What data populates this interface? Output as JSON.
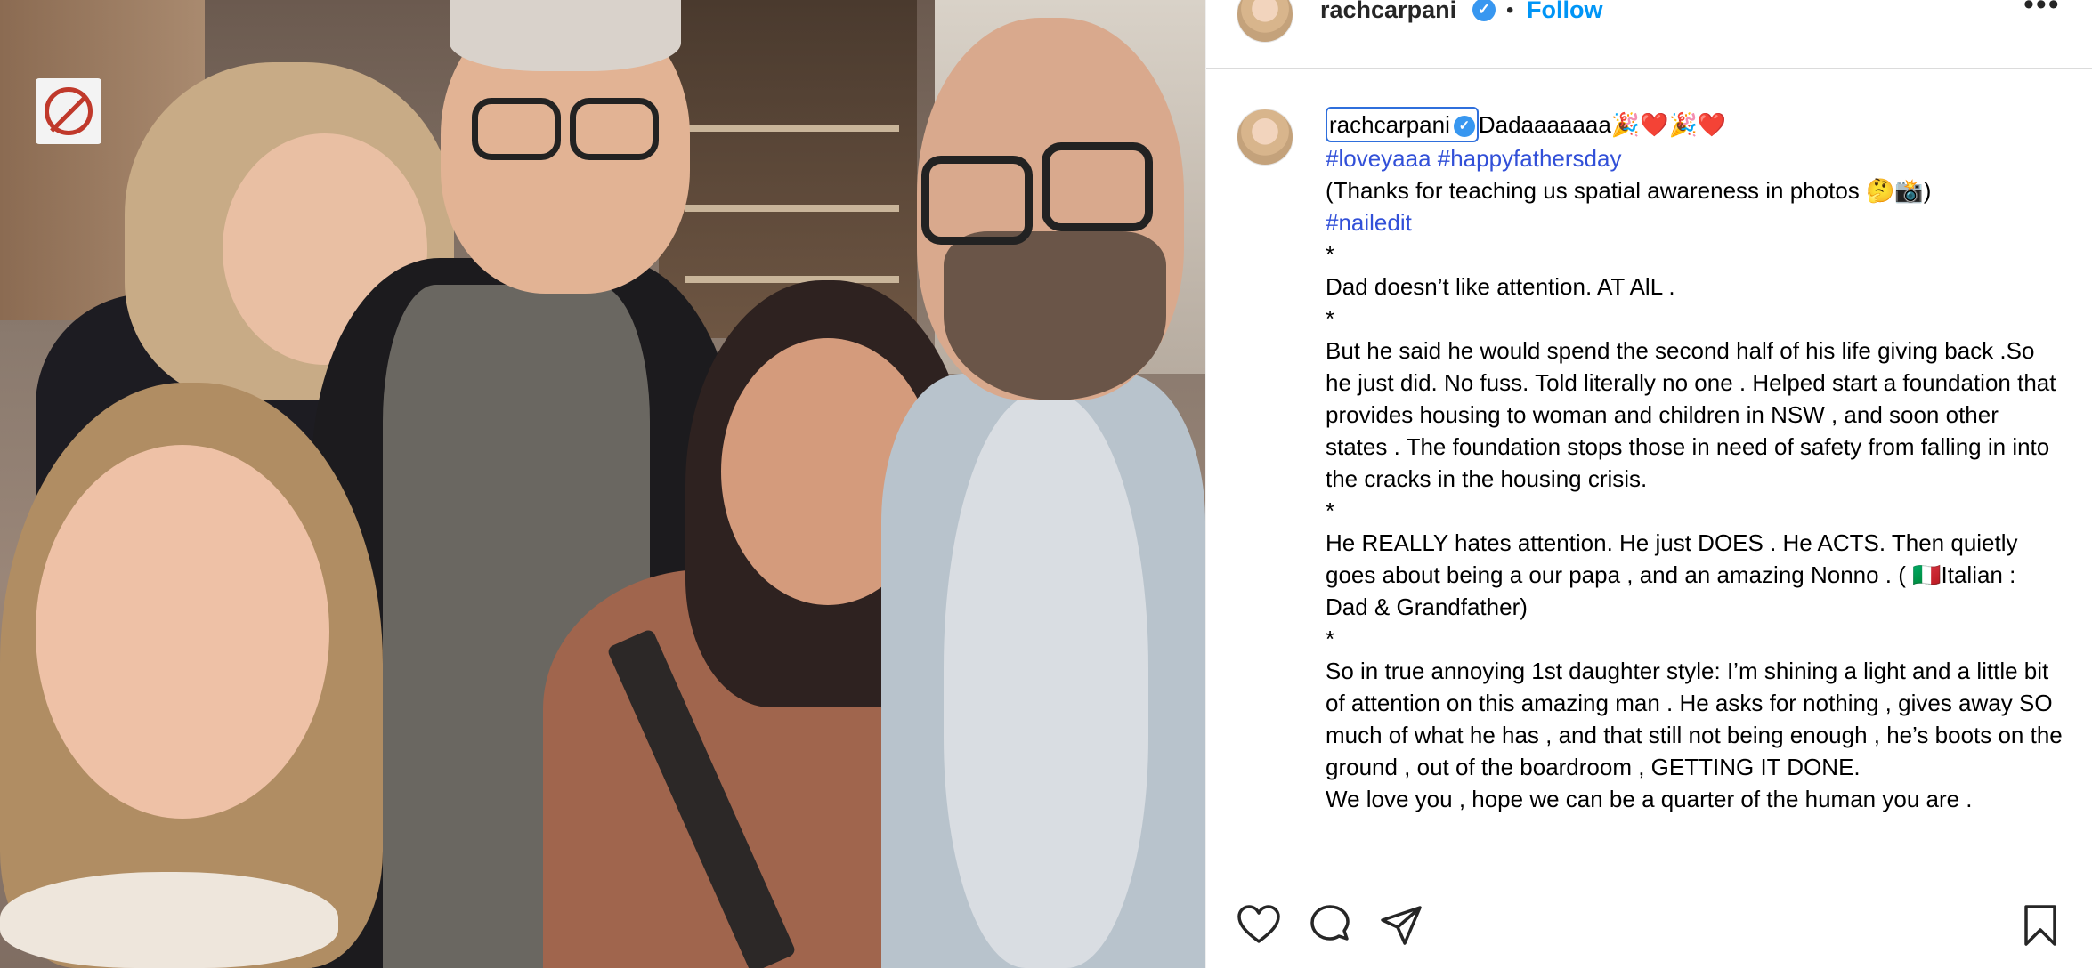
{
  "post": {
    "username": "rachcarpani",
    "verified_glyph": "✓",
    "follow_label": "Follow",
    "separator": "•",
    "more_glyph": "•••"
  },
  "caption": {
    "first_line_text": "Dadaaaaaaa🎉❤️🎉❤️",
    "hashtags_1": "#loveyaaa #happyfathersday",
    "thanks": "(Thanks for teaching us spatial awareness in photos 🤔📸)",
    "hashtags_2": "#nailedit",
    "star_1": "*",
    "para_1": "Dad doesn’t like attention. AT AlL .",
    "star_2": "*",
    "para_2": "But he said he would spend the second half of his life giving back .So he just did. No fuss. Told literally no one . Helped start a foundation that provides housing to woman and children in NSW , and soon other states . The foundation stops those in need of safety from falling in into the cracks in the housing crisis.",
    "star_3": "*",
    "para_3": "He REALLY hates attention. He just DOES . He ACTS. Then quietly goes about being a our papa , and an amazing Nonno . ( 🇮🇹Italian : Dad & Grandfather)",
    "star_4": "*",
    "para_4": "So in true annoying 1st daughter style: I’m shining a light and a little bit of attention on this amazing man . He asks for nothing , gives away SO much of what he has , and that still not being enough , he’s boots on the ground , out of the boardroom , GETTING IT DONE.",
    "para_5": "We love you , hope we can be a quarter of the human you are ."
  },
  "icons": {
    "avatar": "profile-avatar",
    "like": "heart-icon",
    "comment": "comment-bubble-icon",
    "share": "paper-plane-icon",
    "save": "bookmark-icon",
    "photo_sign": "no-smoking-sign"
  },
  "colors": {
    "link_blue": "#0095f6",
    "hashtag_blue": "#3250d8",
    "verified_blue": "#3897f0",
    "focus_outline": "#2f6fdc"
  }
}
